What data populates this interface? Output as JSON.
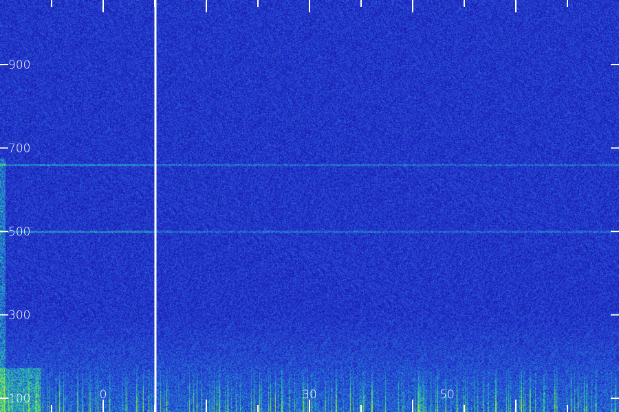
{
  "chart_data": {
    "type": "heatmap",
    "title": "",
    "xlabel": "",
    "ylabel": "",
    "y_ticks": [
      {
        "value": 900,
        "label": "900"
      },
      {
        "value": 700,
        "label": "700"
      },
      {
        "value": 500,
        "label": "500"
      },
      {
        "value": 300,
        "label": "300"
      },
      {
        "value": 100,
        "label": "100"
      }
    ],
    "ylim": [
      100,
      900
    ],
    "x_ticks": [
      {
        "value": 0,
        "label": "0"
      },
      {
        "value": 30,
        "label": "30"
      },
      {
        "value": 50,
        "label": "50"
      }
    ],
    "colormap": [
      "#000040",
      "#1010a0",
      "#2a3cd8",
      "#1f8fd0",
      "#33d890",
      "#a8f020"
    ],
    "background_color": "#12127a",
    "tick_color": "#ffffff",
    "bands": [
      {
        "y": 660,
        "note_value": 660
      },
      {
        "y": 500,
        "note_value": 500
      }
    ]
  }
}
